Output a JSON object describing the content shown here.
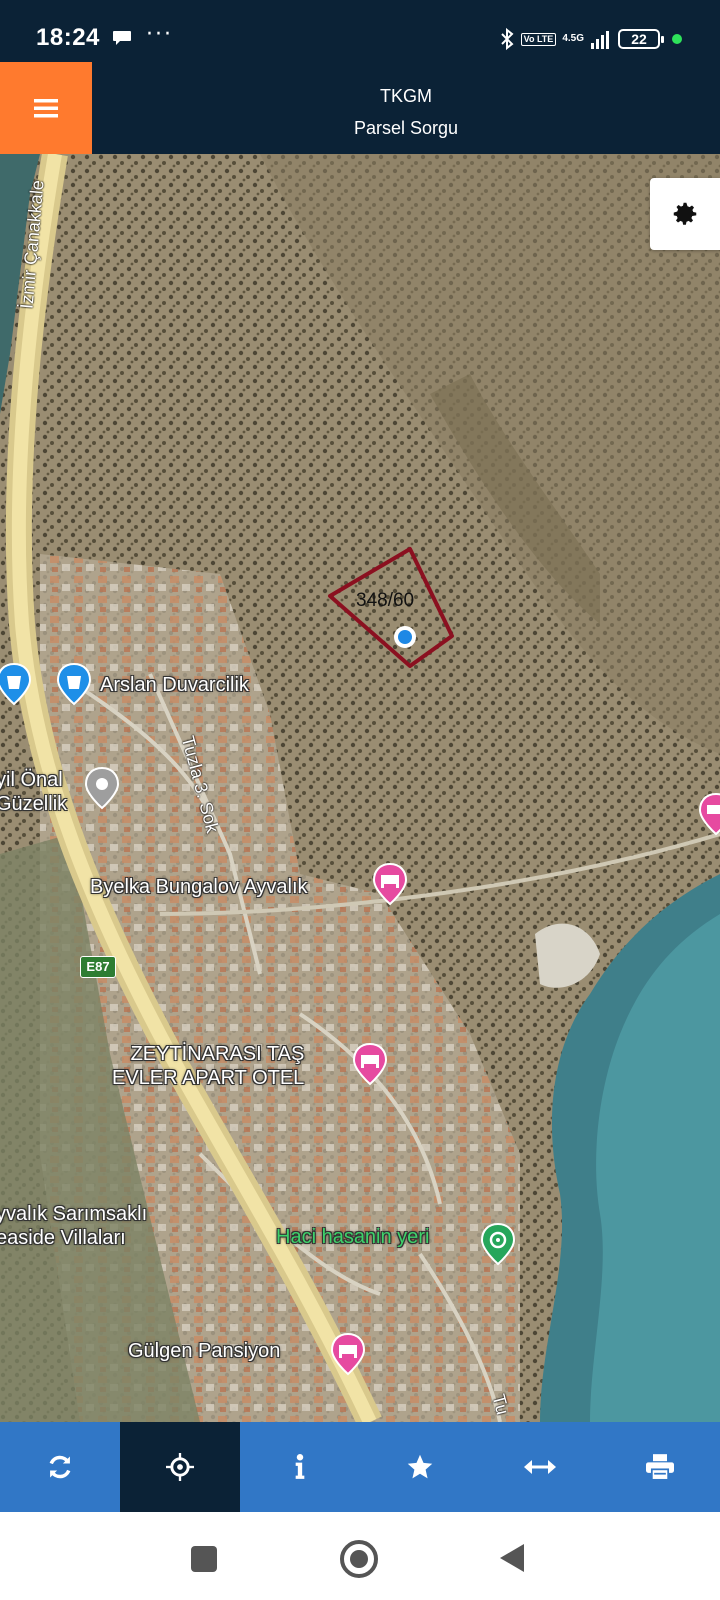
{
  "status_bar": {
    "time": "18:24",
    "overflow_dots": "···",
    "volte": "Vo LTE",
    "network": "4.5G",
    "battery": "22"
  },
  "header": {
    "title": "TKGM",
    "subtitle": "Parsel Sorgu",
    "menu_icon": "hamburger-icon",
    "colors": {
      "menu_bg": "#ff7a2e",
      "header_bg": "#0b2236"
    }
  },
  "map": {
    "parcel_label": "348/60",
    "parcel_color": "#8b1020",
    "road_labels": {
      "highway": "İzmir Çanakkale",
      "tuzla": "Tuzla 3. Sok",
      "tu": "Tu",
      "route_badge": "E87"
    },
    "places": [
      {
        "name": "Arslan Duvarcilik",
        "type": "store"
      },
      {
        "name": "yil Önal\nGüzellik",
        "type": "beauty"
      },
      {
        "name": "Byelka Bungalov Ayvalık",
        "type": "hotel"
      },
      {
        "name": "ZEYTİNARASI TAŞ\nEVLER APART OTEL",
        "type": "hotel"
      },
      {
        "name": "yvalık Sarımsaklı\neaside Villaları",
        "type": "villa"
      },
      {
        "name": "Haci hasanin yeri",
        "type": "restaurant"
      },
      {
        "name": "Gülgen Pansiyon",
        "type": "hotel"
      }
    ],
    "settings_icon": "gear-icon"
  },
  "toolbar": {
    "items": [
      {
        "icon": "refresh-icon",
        "active": false
      },
      {
        "icon": "crosshair-icon",
        "active": true
      },
      {
        "icon": "info-icon",
        "active": false
      },
      {
        "icon": "star-icon",
        "active": false
      },
      {
        "icon": "measure-icon",
        "active": false
      },
      {
        "icon": "print-icon",
        "active": false
      }
    ],
    "colors": {
      "bg": "#3177c6",
      "active_bg": "#0b2236"
    }
  }
}
